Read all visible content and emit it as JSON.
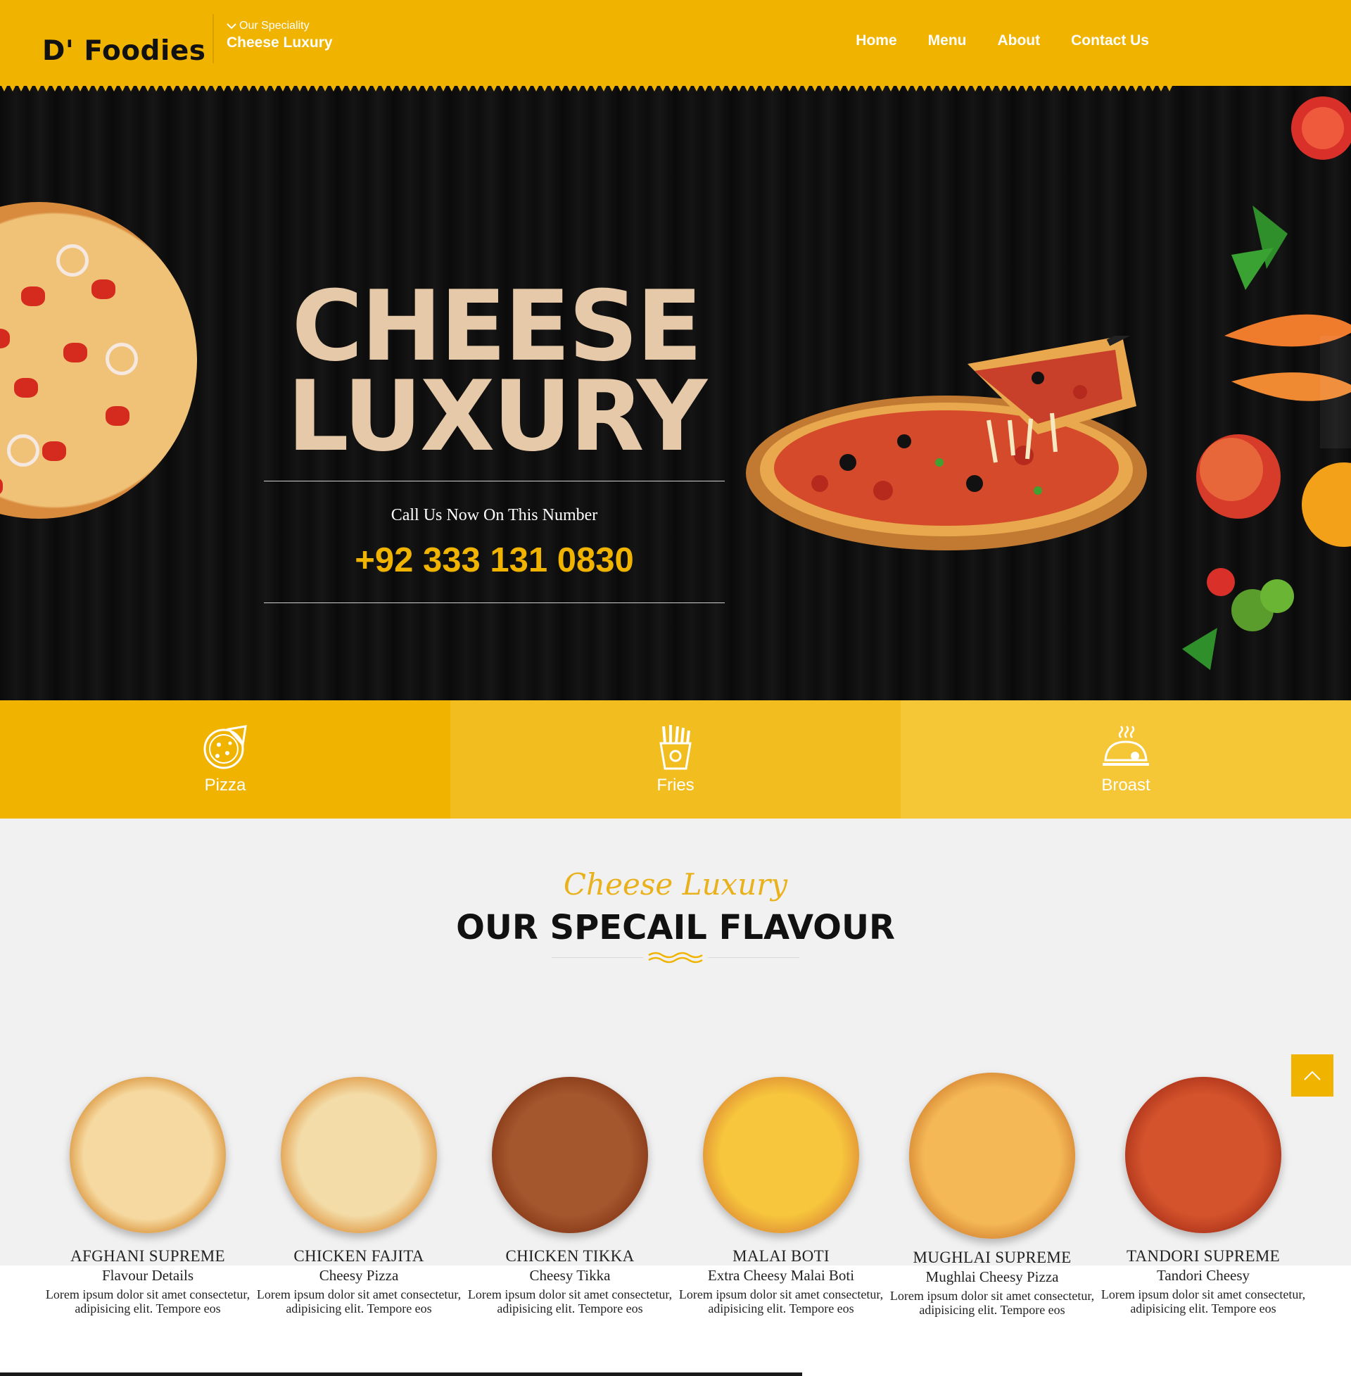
{
  "header": {
    "logo": "D' Foodies",
    "speciality_label": "Our Speciality",
    "speciality_value": "Cheese Luxury",
    "nav": [
      "Home",
      "Menu",
      "About",
      "Contact Us"
    ]
  },
  "hero": {
    "title_line1": "CHEESE",
    "title_line2": "LUXURY",
    "call_text": "Call Us Now On This Number",
    "phone": "+92 333 131 0830"
  },
  "categories": [
    {
      "label": "Pizza",
      "icon": "pizza-icon",
      "color": "#f0b400"
    },
    {
      "label": "Fries",
      "icon": "fries-icon",
      "color": "#f2bd1e"
    },
    {
      "label": "Broast",
      "icon": "broast-icon",
      "color": "#f5c635"
    }
  ],
  "section": {
    "script_title": "Cheese Luxury",
    "title": "OUR SPECAIL FLAVOUR"
  },
  "products": [
    {
      "name": "AFGHANI SUPREME",
      "sub": "Flavour Details",
      "desc": "Lorem ipsum dolor sit amet consectetur, adipisicing elit. Tempore eos"
    },
    {
      "name": "CHICKEN FAJITA",
      "sub": "Cheesy Pizza",
      "desc": "Lorem ipsum dolor sit amet consectetur, adipisicing elit. Tempore eos"
    },
    {
      "name": "CHICKEN TIKKA",
      "sub": "Cheesy Tikka",
      "desc": "Lorem ipsum dolor sit amet consectetur, adipisicing elit. Tempore eos"
    },
    {
      "name": "MALAI BOTI",
      "sub": "Extra Cheesy Malai Boti",
      "desc": "Lorem ipsum dolor sit amet consectetur, adipisicing elit. Tempore eos"
    },
    {
      "name": "MUGHLAI SUPREME",
      "sub": "Mughlai Cheesy Pizza",
      "desc": "Lorem ipsum dolor sit amet consectetur, adipisicing elit. Tempore eos"
    },
    {
      "name": "TANDORI SUPREME",
      "sub": "Tandori Cheesy",
      "desc": "Lorem ipsum dolor sit amet consectetur, adipisicing elit. Tempore eos"
    }
  ],
  "colors": {
    "accent": "#f0b400",
    "hero_title": "#e6c9a8",
    "dark": "#0b0b0b"
  }
}
